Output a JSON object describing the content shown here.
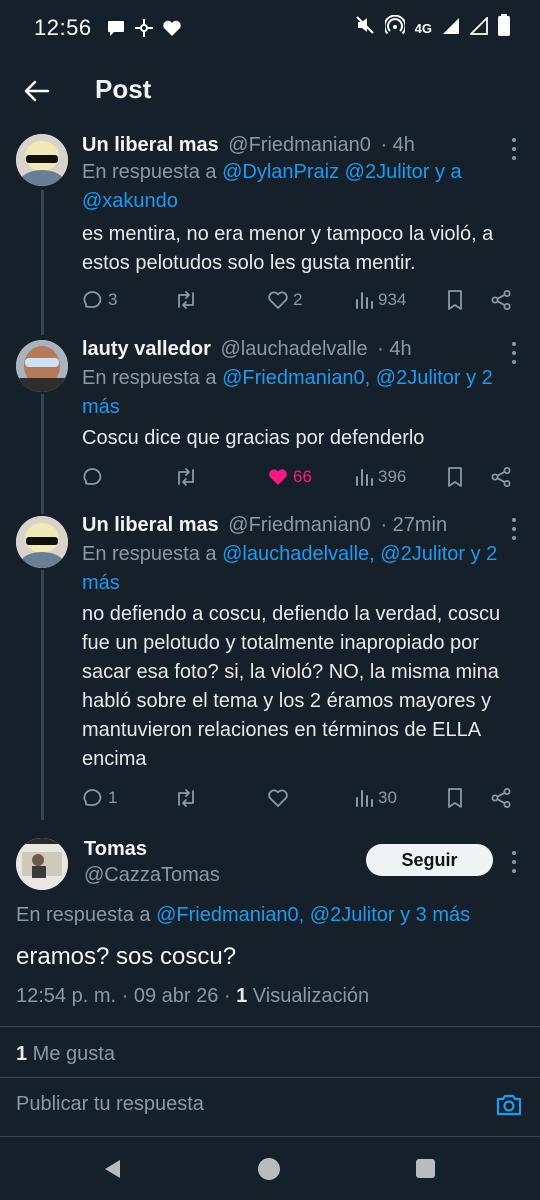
{
  "status_bar": {
    "time": "12:56",
    "network": "4G",
    "left_icons": [
      "message-bubble-icon",
      "pinwheel-icon",
      "heart-icon"
    ],
    "right_icons": [
      "mute-icon",
      "hotspot-icon",
      "signal-icon",
      "battery-icon"
    ]
  },
  "header": {
    "title": "Post"
  },
  "replies": [
    {
      "name": "Un liberal mas",
      "handle": "@Friedmanian0",
      "time": "· 4h",
      "reply_prefix": "En respuesta a ",
      "reply_links": "@DylanPraiz @2Julitor y a",
      "reply_line2": "@xakundo",
      "body": "es mentira, no era menor y tampoco la violó, a estos pelotudos solo les gusta mentir.",
      "replies": "3",
      "retweets": "",
      "likes": "2",
      "views": "934"
    },
    {
      "name": "lauty valledor",
      "handle": "@lauchadelvalle",
      "time": "· 4h",
      "reply_prefix": "En respuesta a ",
      "reply_links": "@Friedmanian0, @2Julitor y 2",
      "reply_line2": "más",
      "body": "Coscu dice que gracias por defenderlo",
      "replies": "",
      "retweets": "",
      "likes": "66",
      "views": "396"
    },
    {
      "name": "Un liberal mas",
      "handle": "@Friedmanian0",
      "time": "· 27min",
      "reply_prefix": "En respuesta a ",
      "reply_links": "@lauchadelvalle, @2Julitor y 2",
      "reply_line2": "más",
      "body": "no defiendo a coscu, defiendo la verdad, coscu fue un pelotudo y totalmente inapropiado por sacar esa foto? si, la violó? NO, la misma mina habló sobre el tema y los 2 éramos mayores y mantuvieron relaciones en términos de ELLA encima",
      "replies": "1",
      "retweets": "",
      "likes": "",
      "views": "30"
    }
  ],
  "focused": {
    "name": "Tomas",
    "handle": "@CazzaTomas",
    "follow_label": "Seguir",
    "reply_prefix": "En respuesta a ",
    "reply_links": "@Friedmanian0, @2Julitor y 3 más",
    "body": "eramos? sos coscu?",
    "timestamp": "12:54 p. m. · 09 abr 26 · ",
    "views_count": "1",
    "views_label": " Visualización",
    "likes_count": "1",
    "likes_label": " Me gusta"
  },
  "composer": {
    "placeholder": "Publicar tu respuesta"
  },
  "colors": {
    "background": "#15202b",
    "accent": "#1d9bf0",
    "like": "#f91880",
    "muted": "#8b98a5"
  }
}
